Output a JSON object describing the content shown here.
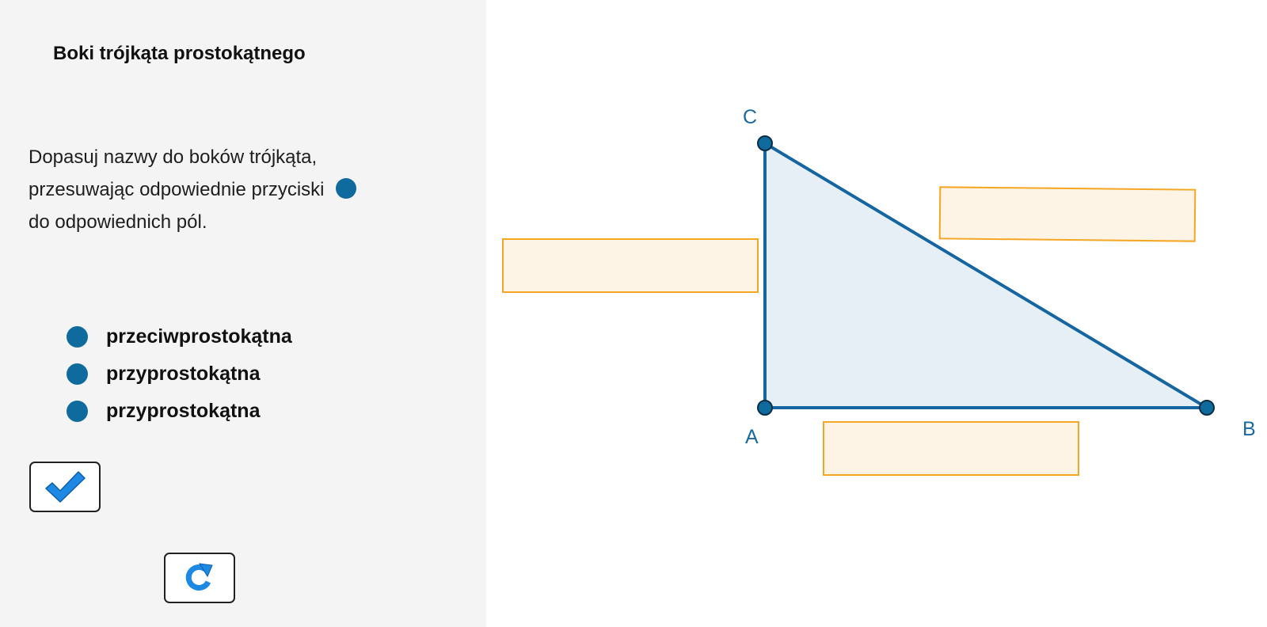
{
  "panel": {
    "title": "Boki trójkąta prostokątnego",
    "instruction": {
      "line1": "Dopasuj nazwy do boków trójkąta,",
      "line2": "przesuwając odpowiednie przyciski",
      "line3": "do odpowiednich pól."
    },
    "options": [
      {
        "label": "przeciwprostokątna"
      },
      {
        "label": "przyprostokątna"
      },
      {
        "label": "przyprostokątna"
      }
    ],
    "check_button_icon": "checkmark-icon",
    "reset_button_icon": "redo-icon"
  },
  "triangle": {
    "vertices": {
      "a": "A",
      "b": "B",
      "c": "C"
    },
    "dropzones": [
      {
        "side": "AC",
        "value": ""
      },
      {
        "side": "BC",
        "value": ""
      },
      {
        "side": "AB",
        "value": ""
      }
    ]
  },
  "colors": {
    "triangle_stroke": "#1565a0",
    "triangle_fill": "#e6eff6",
    "handle": "#0f6b9e",
    "dropzone_fill": "#fdf4e5",
    "dropzone_border": "#f5a623",
    "icon_blue": "#1e88e5"
  }
}
